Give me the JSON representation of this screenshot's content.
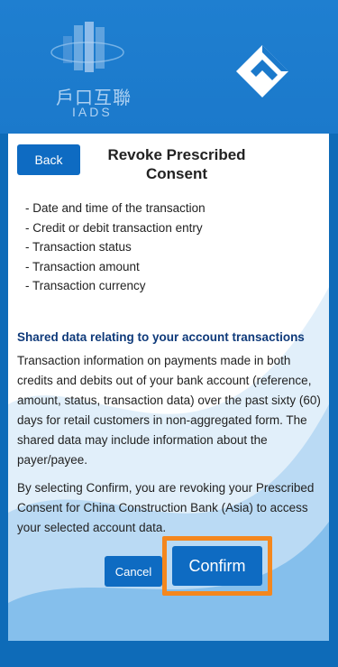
{
  "header": {
    "iads_chinese": "戶口互聯",
    "iads_english": "IADS"
  },
  "page": {
    "back_label": "Back",
    "title": "Revoke Prescribed Consent"
  },
  "fields": [
    "- Date and time of the transaction",
    "- Credit or debit transaction entry",
    "- Transaction status",
    "- Transaction amount",
    "- Transaction currency"
  ],
  "shared_data": {
    "heading": "Shared data relating to your account transactions",
    "body": "Transaction information on payments made in both credits and debits out of your bank account (reference, amount, status, transaction data) over the past sixty (60) days for retail customers in non-aggregated form. The shared data may include information about the payer/payee."
  },
  "confirm_text": "By selecting Confirm, you are revoking your Prescribed Consent for China Construction Bank (Asia) to access your selected account data.",
  "actions": {
    "cancel_label": "Cancel",
    "confirm_label": "Confirm"
  },
  "colors": {
    "brand_blue": "#0e6bc2",
    "highlight": "#f4871e"
  }
}
